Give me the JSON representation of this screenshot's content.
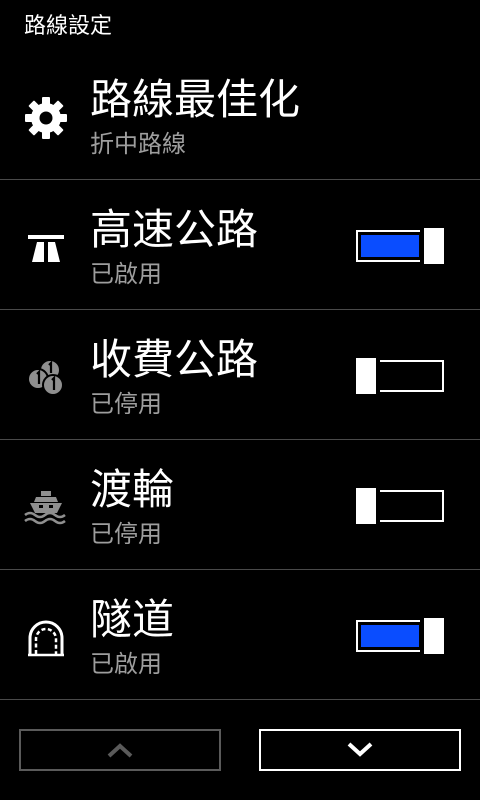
{
  "header": {
    "title": "路線設定"
  },
  "rows": [
    {
      "title": "路線最佳化",
      "status": "折中路線",
      "icon": "gear-icon"
    },
    {
      "title": "高速公路",
      "status": "已啟用",
      "icon": "highway-icon",
      "toggle": "on"
    },
    {
      "title": "收費公路",
      "status": "已停用",
      "icon": "coins-icon",
      "toggle": "off"
    },
    {
      "title": "渡輪",
      "status": "已停用",
      "icon": "ferry-icon",
      "toggle": "off"
    },
    {
      "title": "隧道",
      "status": "已啟用",
      "icon": "tunnel-icon",
      "toggle": "on"
    }
  ],
  "nav": {
    "up_icon": "chevron-up-icon",
    "down_icon": "chevron-down-icon"
  },
  "colors": {
    "accent": "#0a4dff",
    "subtext": "#9e9e9e",
    "divider": "#4a4a4a",
    "disabled_border": "#5a5a5a"
  }
}
